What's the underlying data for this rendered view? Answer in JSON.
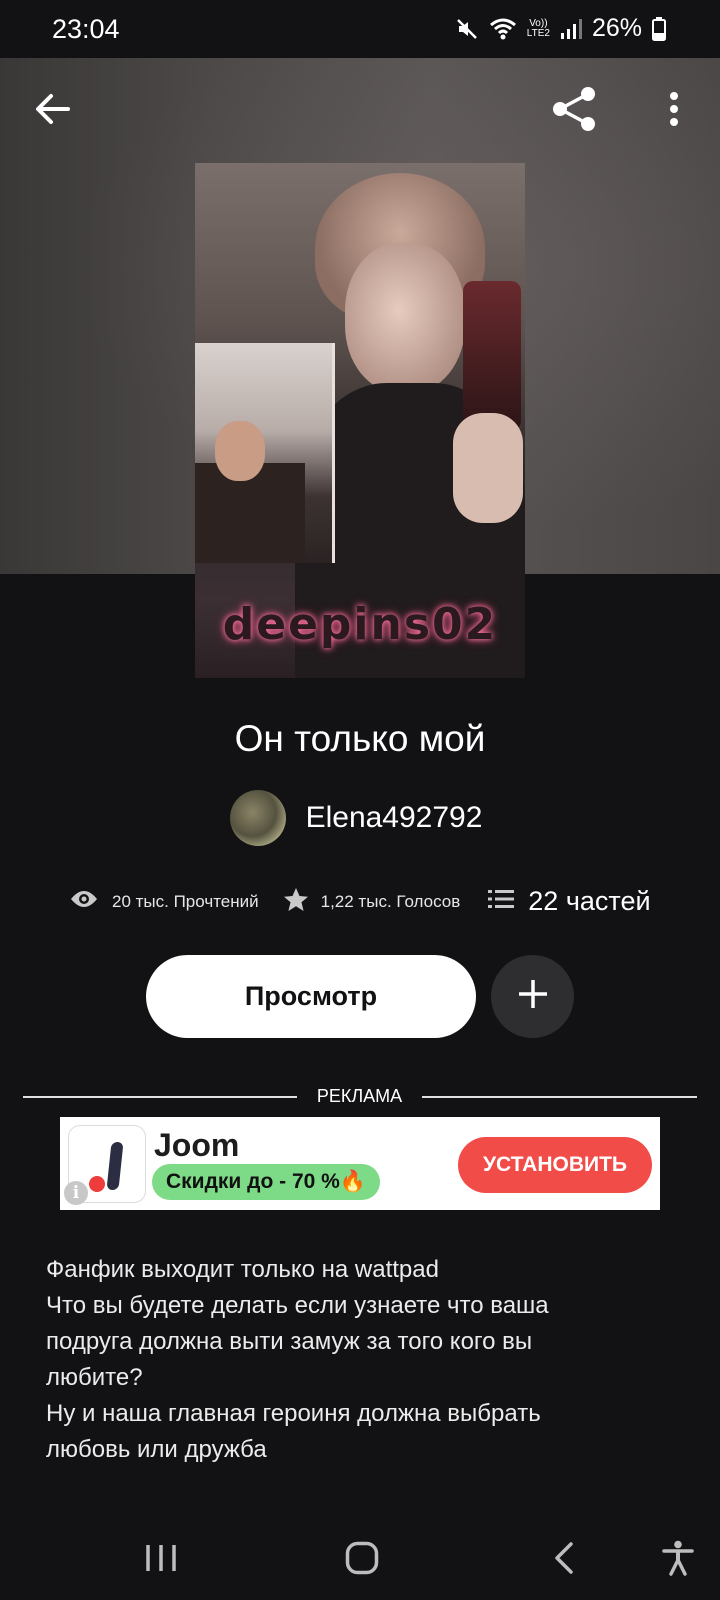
{
  "status_bar": {
    "time": "23:04",
    "battery": "26%",
    "network": "LTE2",
    "volte": "Vo))"
  },
  "header": {
    "back_icon": "arrow-left-icon",
    "share_icon": "share-icon",
    "more_icon": "more-vert-icon"
  },
  "cover": {
    "watermark": "deepins02"
  },
  "story": {
    "title": "Он только мой",
    "author": "Elena492792",
    "stats": {
      "reads": "20 тыс. Прочтений",
      "votes": "1,22 тыс. Голосов",
      "parts": "22 частей"
    },
    "view_button": "Просмотр",
    "add_icon": "plus-icon"
  },
  "ad": {
    "label": "РЕКЛАМА",
    "title": "Joom",
    "promo": "Скидки до - 70 %🔥",
    "install": "УСТАНОВИТЬ",
    "info": "i"
  },
  "description": {
    "lines": [
      "Фанфик выходит только на wattpad",
      "Что вы будете делать если узнаете что ваша",
      "подруга должна выти замуж за того кого вы",
      "любите?",
      "Ну и наша главная героиня должна выбрать",
      "любовь или дружба"
    ]
  },
  "nav": {
    "recents_icon": "recents-icon",
    "home_icon": "home-icon",
    "back_icon": "back-chevron-icon",
    "accessibility_icon": "accessibility-icon"
  },
  "colors": {
    "background": "#121114",
    "button_bg": "#ffffff",
    "install": "#f24c48",
    "promo": "#7ddb87"
  }
}
